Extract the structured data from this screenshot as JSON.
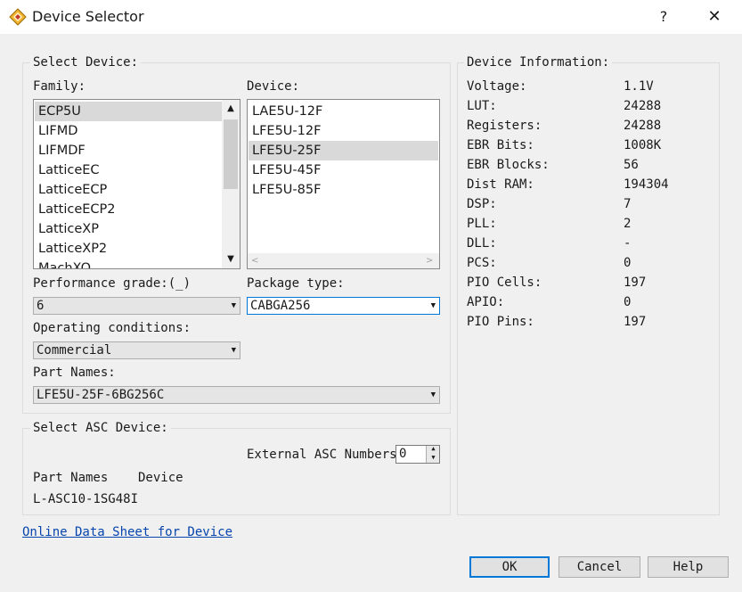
{
  "window": {
    "title": "Device Selector",
    "help_glyph": "?",
    "close_glyph": "✕"
  },
  "select_device": {
    "legend": "Select Device:",
    "family_label": "Family:",
    "device_label": "Device:",
    "families": [
      "ECP5U",
      "LIFMD",
      "LIFMDF",
      "LatticeEC",
      "LatticeECP",
      "LatticeECP2",
      "LatticeXP",
      "LatticeXP2",
      "MachXO"
    ],
    "devices": [
      "LAE5U-12F",
      "LFE5U-12F",
      "LFE5U-25F",
      "LFE5U-45F",
      "LFE5U-85F"
    ],
    "performance_label": "Performance grade:(_)",
    "performance_value": "6",
    "package_label": "Package type:",
    "package_value": "CABGA256",
    "operating_label": "Operating conditions:",
    "operating_value": "Commercial",
    "part_names_label": "Part Names:",
    "part_names_value": "LFE5U-25F-6BG256C"
  },
  "asc": {
    "legend": "Select ASC Device:",
    "external_label": "External ASC Numbers",
    "external_value": "0",
    "col_part": "Part Names",
    "col_device": "Device",
    "part": "L-ASC10-1SG48I"
  },
  "device_info": {
    "legend": "Device Information:",
    "rows": [
      {
        "k": "Voltage:",
        "v": "1.1V"
      },
      {
        "k": "LUT:",
        "v": "24288"
      },
      {
        "k": "Registers:",
        "v": "24288"
      },
      {
        "k": "EBR Bits:",
        "v": "1008K"
      },
      {
        "k": "EBR Blocks:",
        "v": "56"
      },
      {
        "k": "Dist RAM:",
        "v": "194304"
      },
      {
        "k": "DSP:",
        "v": "7"
      },
      {
        "k": "PLL:",
        "v": "2"
      },
      {
        "k": "DLL:",
        "v": "-"
      },
      {
        "k": "PCS:",
        "v": "0"
      },
      {
        "k": "PIO Cells:",
        "v": "197"
      },
      {
        "k": "APIO:",
        "v": "0"
      },
      {
        "k": "PIO Pins:",
        "v": "197"
      }
    ]
  },
  "link": "Online Data Sheet for Device",
  "buttons": {
    "ok": "OK",
    "cancel": "Cancel",
    "help": "Help"
  },
  "colors": {
    "accent": "#0078d7",
    "link": "#0645ad",
    "selection": "#d9d9d9"
  }
}
